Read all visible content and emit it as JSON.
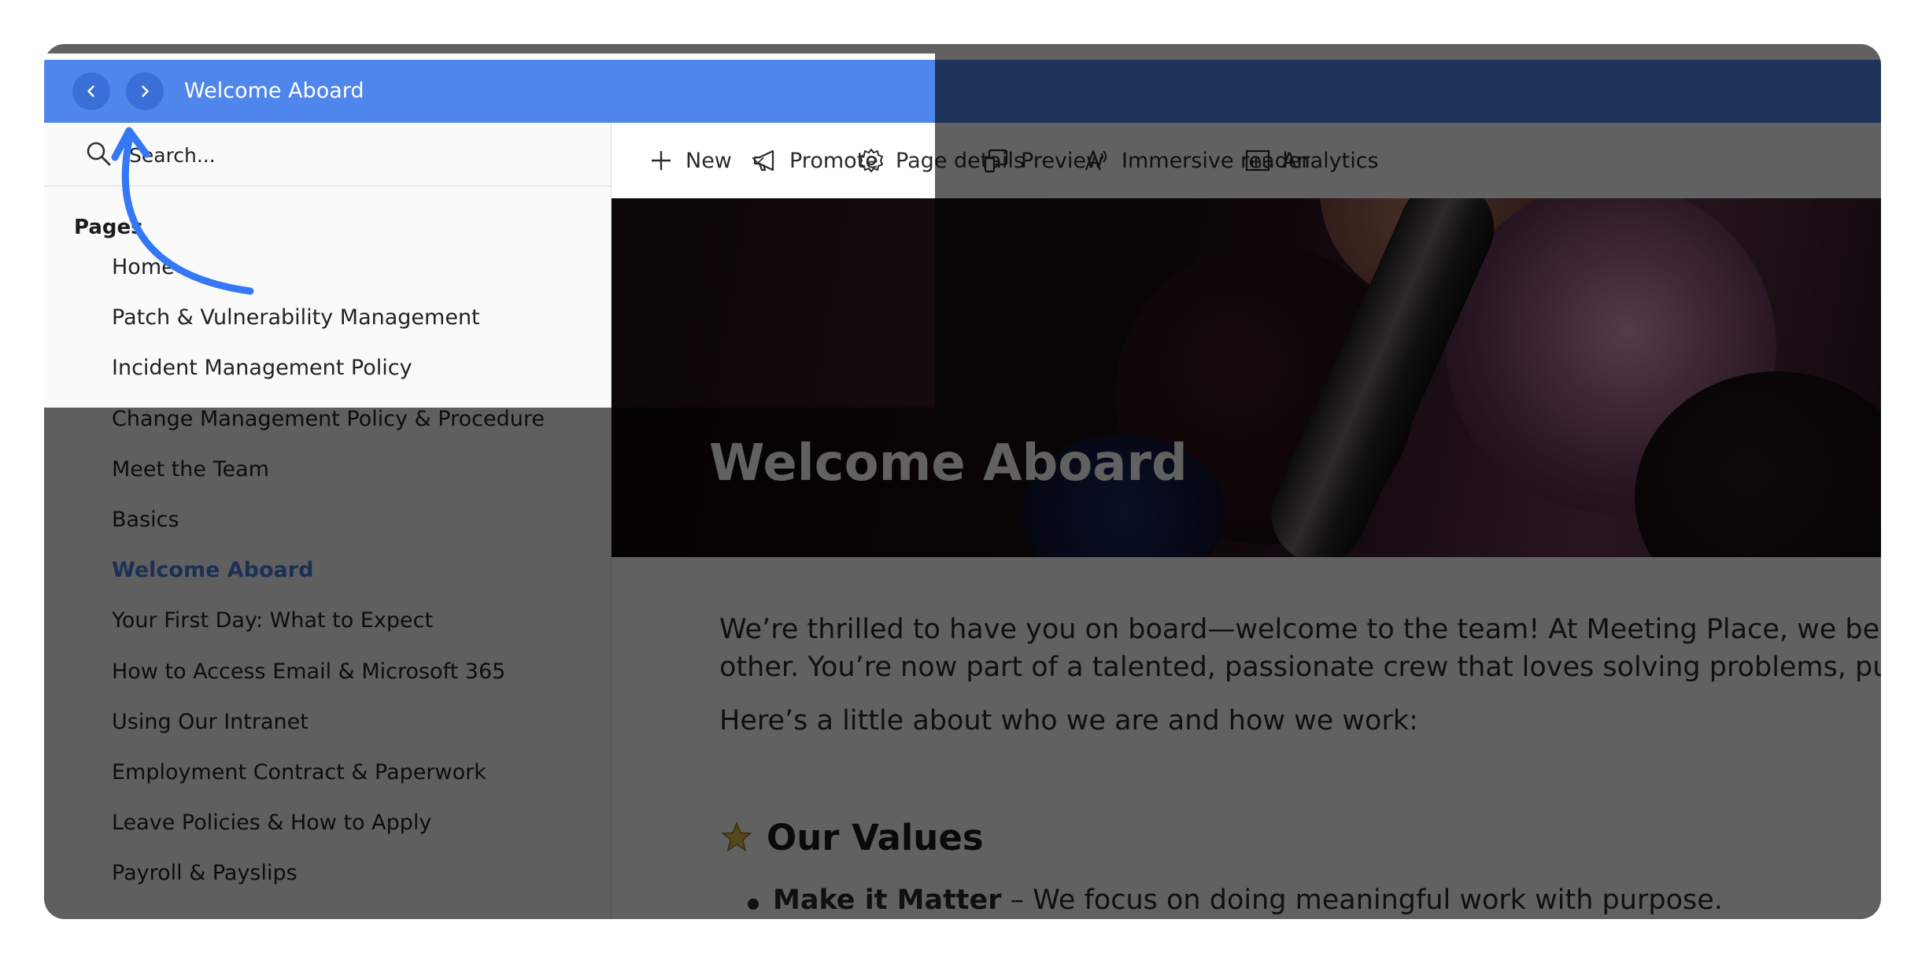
{
  "titlebar": {
    "title": "Welcome Aboard",
    "back_icon": "chevron-left-icon",
    "forward_icon": "chevron-right-icon"
  },
  "sidebar": {
    "search_placeholder": "Search...",
    "pages_heading": "Pages",
    "pages": [
      {
        "label": "Home"
      },
      {
        "label": "Patch & Vulnerability Management"
      },
      {
        "label": "Incident Management Policy"
      },
      {
        "label": "Change Management Policy & Procedure"
      },
      {
        "label": "Meet the Team"
      },
      {
        "label": "Basics"
      },
      {
        "label": "Welcome Aboard",
        "active": true
      },
      {
        "label": "Your First Day: What to Expect"
      },
      {
        "label": "How to Access Email & Microsoft 365"
      },
      {
        "label": "Using Our Intranet"
      },
      {
        "label": "Employment Contract & Paperwork"
      },
      {
        "label": "Leave Policies & How to Apply"
      },
      {
        "label": "Payroll & Payslips"
      }
    ]
  },
  "commandbar": {
    "new": "New",
    "promote": "Promote",
    "page_details": "Page details",
    "preview": "Preview",
    "immersive_reader": "Immersive reader",
    "analytics": "Analytics"
  },
  "hero": {
    "title": "Welcome Aboard"
  },
  "content": {
    "paragraph1_line1": "We’re thrilled to have you on board—welcome to the team! At Meeting Place, we believe in b",
    "paragraph1_line2": "other. You’re now part of a talented, passionate crew that loves solving problems, pushing bo",
    "paragraph2": "Here’s a little about who we are and how we work:",
    "values_heading": "Our Values",
    "values_icon": "star-badge-icon",
    "bullet_bold": "Make it Matter",
    "bullet_text": " – We focus on doing meaningful work with purpose."
  },
  "colors": {
    "titlebar": "#4f86ec",
    "active_link": "#4a7fe0",
    "annotation_arrow": "#3478f6"
  }
}
